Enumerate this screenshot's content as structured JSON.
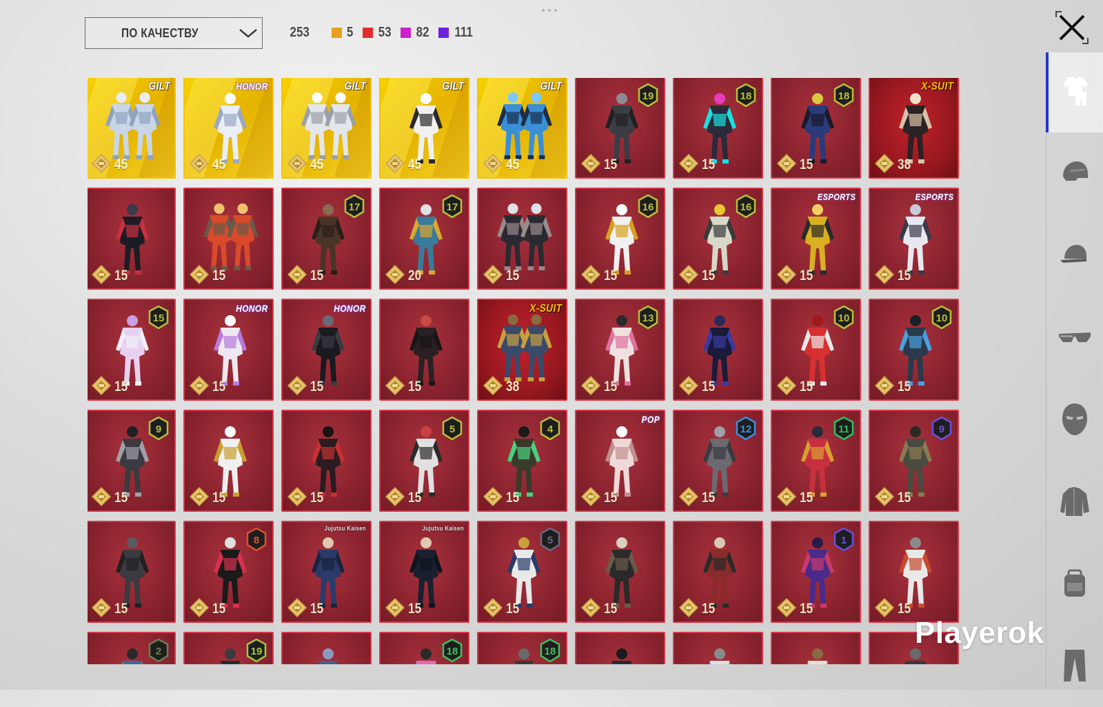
{
  "toolbar": {
    "sort_label": "ПО КАЧЕСТВУ",
    "total_count": "253",
    "counts": [
      {
        "color": "#e8a020",
        "value": "5"
      },
      {
        "color": "#e52c2c",
        "value": "53"
      },
      {
        "color": "#cc22cc",
        "value": "82"
      },
      {
        "color": "#6a22dd",
        "value": "111"
      }
    ]
  },
  "grid": {
    "items": [
      {
        "tier": "gold",
        "value": "45",
        "tag": "GILT",
        "tag_class": "gilt",
        "level": "",
        "level_color": "",
        "pal": [
          "#c9d6e8",
          "#8ea3c0",
          "#e8eef6"
        ],
        "duo": true
      },
      {
        "tier": "gold",
        "value": "45",
        "tag": "HONOR",
        "tag_class": "honor",
        "level": "",
        "level_color": "",
        "pal": [
          "#e9eef6",
          "#9aa8c2",
          "#ffffff"
        ],
        "duo": false
      },
      {
        "tier": "gold",
        "value": "45",
        "tag": "GILT",
        "tag_class": "gilt",
        "level": "",
        "level_color": "",
        "pal": [
          "#e3e6ea",
          "#9aa0a8",
          "#ffffff"
        ],
        "duo": true
      },
      {
        "tier": "gold",
        "value": "45",
        "tag": "GILT",
        "tag_class": "gilt",
        "level": "",
        "level_color": "",
        "pal": [
          "#f0f0f0",
          "#2a2a2a",
          "#ffffff"
        ],
        "duo": false
      },
      {
        "tier": "gold",
        "value": "45",
        "tag": "GILT",
        "tag_class": "gilt",
        "level": "",
        "level_color": "",
        "pal": [
          "#3a8fd6",
          "#1c2d4a",
          "#7cc8ff"
        ],
        "duo": true
      },
      {
        "tier": "red",
        "value": "15",
        "tag": "",
        "tag_class": "",
        "level": "19",
        "level_color": "#b8c03a",
        "pal": [
          "#3c3c44",
          "#202024",
          "#8c8c96"
        ],
        "duo": false
      },
      {
        "tier": "red",
        "value": "15",
        "tag": "",
        "tag_class": "",
        "level": "18",
        "level_color": "#b8c03a",
        "pal": [
          "#2a2a3a",
          "#18e0e0",
          "#e83cbc"
        ],
        "duo": false
      },
      {
        "tier": "red",
        "value": "15",
        "tag": "",
        "tag_class": "",
        "level": "18",
        "level_color": "#b8c03a",
        "pal": [
          "#2a3a7a",
          "#1a1a2a",
          "#d8c840"
        ],
        "duo": false
      },
      {
        "tier": "xsuit",
        "value": "38",
        "tag": "X-SUIT",
        "tag_class": "xsuit",
        "level": "",
        "level_color": "",
        "pal": [
          "#2a2224",
          "#d8c0a8",
          "#f0e0c8"
        ],
        "duo": false
      },
      {
        "tier": "red",
        "value": "15",
        "tag": "",
        "tag_class": "",
        "level": "",
        "level_color": "",
        "pal": [
          "#1c1c24",
          "#c83040",
          "#3a3a4a"
        ],
        "duo": false
      },
      {
        "tier": "red",
        "value": "15",
        "tag": "",
        "tag_class": "",
        "level": "",
        "level_color": "",
        "pal": [
          "#d84a2a",
          "#6a5a4a",
          "#f0c070"
        ],
        "duo": true
      },
      {
        "tier": "red",
        "value": "15",
        "tag": "",
        "tag_class": "",
        "level": "17",
        "level_color": "#b8c03a",
        "pal": [
          "#4a3428",
          "#2a1e18",
          "#8a6a50"
        ],
        "duo": false
      },
      {
        "tier": "red",
        "value": "20",
        "tag": "",
        "tag_class": "",
        "level": "17",
        "level_color": "#b8c03a",
        "pal": [
          "#3a7a9a",
          "#d8a830",
          "#e0e0e0"
        ],
        "duo": false
      },
      {
        "tier": "red",
        "value": "15",
        "tag": "",
        "tag_class": "",
        "level": "",
        "level_color": "",
        "pal": [
          "#2a2a32",
          "#9a8a8a",
          "#e0e0e8"
        ],
        "duo": true
      },
      {
        "tier": "red",
        "value": "15",
        "tag": "",
        "tag_class": "",
        "level": "16",
        "level_color": "#b8c03a",
        "pal": [
          "#f0f0f0",
          "#d8a020",
          "#ffffff"
        ],
        "duo": false
      },
      {
        "tier": "red",
        "value": "15",
        "tag": "",
        "tag_class": "",
        "level": "16",
        "level_color": "#b8c03a",
        "pal": [
          "#d8d8c8",
          "#3a3a3a",
          "#e8c830"
        ],
        "duo": false
      },
      {
        "tier": "red",
        "value": "15",
        "tag": "ESPORTS",
        "tag_class": "esports",
        "level": "",
        "level_color": "",
        "pal": [
          "#d8b020",
          "#2a2a2a",
          "#f0d060"
        ],
        "duo": false
      },
      {
        "tier": "red",
        "value": "15",
        "tag": "ESPORTS",
        "tag_class": "esports",
        "level": "",
        "level_color": "",
        "pal": [
          "#e8e8f0",
          "#3a3a4a",
          "#c8c8d8"
        ],
        "duo": false
      },
      {
        "tier": "red",
        "value": "15",
        "tag": "",
        "tag_class": "",
        "level": "15",
        "level_color": "#b8c03a",
        "pal": [
          "#e8d0f0",
          "#f0f0f8",
          "#c8a0e0"
        ],
        "duo": false
      },
      {
        "tier": "red",
        "value": "15",
        "tag": "HONOR",
        "tag_class": "honor",
        "level": "",
        "level_color": "",
        "pal": [
          "#f0e8f0",
          "#b87ae0",
          "#ffffff"
        ],
        "duo": false
      },
      {
        "tier": "red",
        "value": "15",
        "tag": "HONOR",
        "tag_class": "honor",
        "level": "",
        "level_color": "",
        "pal": [
          "#1a1a20",
          "#3a3a44",
          "#6a6a78"
        ],
        "duo": false
      },
      {
        "tier": "red",
        "value": "15",
        "tag": "",
        "tag_class": "",
        "level": "",
        "level_color": "",
        "pal": [
          "#2a2024",
          "#1a1416",
          "#c84a40"
        ],
        "duo": false
      },
      {
        "tier": "xsuit",
        "value": "38",
        "tag": "X-SUIT",
        "tag_class": "xsuit",
        "level": "",
        "level_color": "",
        "pal": [
          "#3a4a6a",
          "#c8a040",
          "#8a6a40"
        ],
        "duo": true
      },
      {
        "tier": "red",
        "value": "15",
        "tag": "",
        "tag_class": "",
        "level": "13",
        "level_color": "#b8c03a",
        "pal": [
          "#f0e0e0",
          "#e070a0",
          "#2a2a2a"
        ],
        "duo": false
      },
      {
        "tier": "red",
        "value": "15",
        "tag": "",
        "tag_class": "",
        "level": "",
        "level_color": "",
        "pal": [
          "#1a1a3a",
          "#3a3aa0",
          "#2a2a5a"
        ],
        "duo": false
      },
      {
        "tier": "red",
        "value": "15",
        "tag": "",
        "tag_class": "",
        "level": "10",
        "level_color": "#b8c03a",
        "pal": [
          "#d83030",
          "#e8e8e8",
          "#a01818"
        ],
        "duo": false
      },
      {
        "tier": "red",
        "value": "15",
        "tag": "",
        "tag_class": "",
        "level": "10",
        "level_color": "#b8c03a",
        "pal": [
          "#2a3a4a",
          "#4aa0e0",
          "#1a2028"
        ],
        "duo": false
      },
      {
        "tier": "red",
        "value": "15",
        "tag": "",
        "tag_class": "",
        "level": "9",
        "level_color": "#b8c03a",
        "pal": [
          "#3a3a40",
          "#a0a0a8",
          "#202024"
        ],
        "duo": false
      },
      {
        "tier": "red",
        "value": "15",
        "tag": "",
        "tag_class": "",
        "level": "",
        "level_color": "",
        "pal": [
          "#f0f0f0",
          "#c8a030",
          "#ffffff"
        ],
        "duo": false
      },
      {
        "tier": "red",
        "value": "15",
        "tag": "",
        "tag_class": "",
        "level": "",
        "level_color": "",
        "pal": [
          "#2a1c20",
          "#c83030",
          "#1a1214"
        ],
        "duo": false
      },
      {
        "tier": "red",
        "value": "15",
        "tag": "",
        "tag_class": "",
        "level": "5",
        "level_color": "#b8c03a",
        "pal": [
          "#e0e0e0",
          "#2a2a2a",
          "#c84040"
        ],
        "duo": false
      },
      {
        "tier": "red",
        "value": "15",
        "tag": "",
        "tag_class": "",
        "level": "4",
        "level_color": "#b8c03a",
        "pal": [
          "#3a3a2a",
          "#4ad080",
          "#1a1a18"
        ],
        "duo": false
      },
      {
        "tier": "red",
        "value": "15",
        "tag": "POP",
        "tag_class": "pop",
        "level": "",
        "level_color": "",
        "pal": [
          "#f0d8d8",
          "#c09090",
          "#ffffff"
        ],
        "duo": false
      },
      {
        "tier": "red",
        "value": "15",
        "tag": "",
        "tag_class": "",
        "level": "12",
        "level_color": "#3a90e0",
        "pal": [
          "#6a6a70",
          "#3a3a40",
          "#a0a0a8"
        ],
        "duo": false
      },
      {
        "tier": "red",
        "value": "15",
        "tag": "",
        "tag_class": "",
        "level": "11",
        "level_color": "#30c060",
        "pal": [
          "#c83040",
          "#d8a030",
          "#2a2a3a"
        ],
        "duo": false
      },
      {
        "tier": "red",
        "value": "15",
        "tag": "",
        "tag_class": "",
        "level": "9",
        "level_color": "#6a50e0",
        "pal": [
          "#4a4a40",
          "#8a7a50",
          "#2a2a24"
        ],
        "duo": false
      },
      {
        "tier": "red",
        "value": "15",
        "tag": "",
        "tag_class": "",
        "level": "",
        "level_color": "",
        "pal": [
          "#3a3a40",
          "#202024",
          "#5a5a60"
        ],
        "duo": false
      },
      {
        "tier": "red",
        "value": "15",
        "tag": "",
        "tag_class": "",
        "level": "8",
        "level_color": "#e05030",
        "pal": [
          "#1a1a1a",
          "#d83050",
          "#e0e0e0"
        ],
        "duo": false
      },
      {
        "tier": "red",
        "value": "15",
        "tag": "Jujutsu Kaisen",
        "tag_class": "jk",
        "level": "",
        "level_color": "",
        "pal": [
          "#2a3a6a",
          "#1a2440",
          "#e0c8b0"
        ],
        "duo": false
      },
      {
        "tier": "red",
        "value": "15",
        "tag": "Jujutsu Kaisen",
        "tag_class": "jk",
        "level": "",
        "level_color": "",
        "pal": [
          "#1a2030",
          "#101420",
          "#e0c8b0"
        ],
        "duo": false
      },
      {
        "tier": "red",
        "value": "15",
        "tag": "",
        "tag_class": "",
        "level": "5",
        "level_color": "#6a6a80",
        "pal": [
          "#e8e8e8",
          "#2a3a6a",
          "#c8a040"
        ],
        "duo": false
      },
      {
        "tier": "red",
        "value": "15",
        "tag": "",
        "tag_class": "",
        "level": "",
        "level_color": "",
        "pal": [
          "#2a2a2a",
          "#6a5a48",
          "#d8d0c0"
        ],
        "duo": false
      },
      {
        "tier": "red",
        "value": "15",
        "tag": "",
        "tag_class": "",
        "level": "",
        "level_color": "",
        "pal": [
          "#8a2a2a",
          "#2a2a2a",
          "#d8c8b0"
        ],
        "duo": false
      },
      {
        "tier": "red",
        "value": "15",
        "tag": "",
        "tag_class": "",
        "level": "1",
        "level_color": "#6a50e0",
        "pal": [
          "#4a2a8a",
          "#c83a6a",
          "#2a1a4a"
        ],
        "duo": false
      },
      {
        "tier": "red",
        "value": "15",
        "tag": "",
        "tag_class": "",
        "level": "",
        "level_color": "",
        "pal": [
          "#e8e8e8",
          "#c84a30",
          "#8a8a8a"
        ],
        "duo": false
      },
      {
        "tier": "red",
        "value": "",
        "tag": "",
        "tag_class": "",
        "level": "2",
        "level_color": "#6a8050",
        "pal": [
          "#3a6a9a",
          "#d8a030",
          "#2a2a2a"
        ],
        "duo": false
      },
      {
        "tier": "red",
        "value": "",
        "tag": "",
        "tag_class": "",
        "level": "19",
        "level_color": "#a0c840",
        "pal": [
          "#2a2a30",
          "#c83040",
          "#3a3a40"
        ],
        "duo": false
      },
      {
        "tier": "red",
        "value": "",
        "tag": "",
        "tag_class": "",
        "level": "",
        "level_color": "",
        "pal": [
          "#4a5a8a",
          "#2a3050",
          "#8a9ac0"
        ],
        "duo": false
      },
      {
        "tier": "red",
        "value": "",
        "tag": "",
        "tag_class": "",
        "level": "18",
        "level_color": "#40c060",
        "pal": [
          "#e06ab0",
          "#4ac0d8",
          "#2a2a2a"
        ],
        "duo": false
      },
      {
        "tier": "red",
        "value": "",
        "tag": "",
        "tag_class": "",
        "level": "18",
        "level_color": "#40c060",
        "pal": [
          "#3a3a3a",
          "#d84050",
          "#6a6a6a"
        ],
        "duo": false
      },
      {
        "tier": "red",
        "value": "",
        "tag": "",
        "tag_class": "",
        "level": "",
        "level_color": "",
        "pal": [
          "#2a2a30",
          "#4a4a50",
          "#1a1a20"
        ],
        "duo": false
      },
      {
        "tier": "red",
        "value": "",
        "tag": "",
        "tag_class": "",
        "level": "",
        "level_color": "",
        "pal": [
          "#e0e0e0",
          "#4ac0e0",
          "#8a8a8a"
        ],
        "duo": false
      },
      {
        "tier": "red",
        "value": "",
        "tag": "",
        "tag_class": "",
        "level": "",
        "level_color": "",
        "pal": [
          "#e8e0d0",
          "#d8a030",
          "#8a6a40"
        ],
        "duo": false
      },
      {
        "tier": "red",
        "value": "",
        "tag": "",
        "tag_class": "",
        "level": "",
        "level_color": "",
        "pal": [
          "#3a3a40",
          "#202024",
          "#6a6a70"
        ],
        "duo": false
      }
    ]
  },
  "sidebar": {
    "tabs": [
      {
        "name": "outfit-tab",
        "icon": "outfit-icon",
        "active": true
      },
      {
        "name": "helmet-tab",
        "icon": "helmet-icon",
        "active": false
      },
      {
        "name": "cap-tab",
        "icon": "cap-icon",
        "active": false
      },
      {
        "name": "glasses-tab",
        "icon": "glasses-icon",
        "active": false
      },
      {
        "name": "mask-tab",
        "icon": "mask-icon",
        "active": false
      },
      {
        "name": "jacket-tab",
        "icon": "jacket-icon",
        "active": false
      },
      {
        "name": "backpack-tab",
        "icon": "backpack-icon",
        "active": false
      },
      {
        "name": "pants-tab",
        "icon": "pants-icon",
        "active": false
      }
    ]
  },
  "watermark": "Playerok"
}
